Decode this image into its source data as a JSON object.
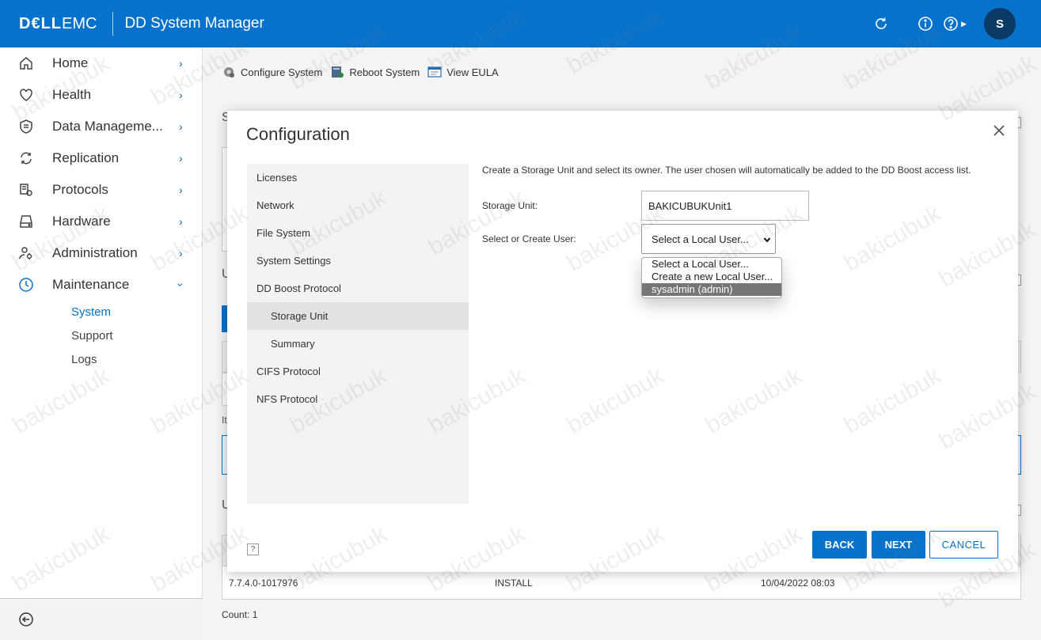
{
  "header": {
    "logo_dell": "D€LL",
    "logo_emc": "EMC",
    "app_title": "DD System Manager",
    "user_initial": "S",
    "icons": [
      "refresh-icon",
      "info-icon",
      "help-icon",
      "user-avatar"
    ]
  },
  "sidebar": {
    "items": [
      {
        "label": "Home",
        "icon": "home-icon"
      },
      {
        "label": "Health",
        "icon": "heart-icon"
      },
      {
        "label": "Data Manageme...",
        "icon": "shield-icon"
      },
      {
        "label": "Replication",
        "icon": "sync-icon"
      },
      {
        "label": "Protocols",
        "icon": "protocols-icon"
      },
      {
        "label": "Hardware",
        "icon": "drive-icon"
      },
      {
        "label": "Administration",
        "icon": "admin-user-icon"
      },
      {
        "label": "Maintenance",
        "icon": "clock-icon"
      }
    ],
    "sub_items": [
      "System",
      "Support",
      "Logs"
    ]
  },
  "toolbar": {
    "configure": "Configure System",
    "reboot": "Reboot System",
    "eula": "View EULA"
  },
  "background": {
    "frag_s": "S",
    "frag_u1": "U",
    "frag_it": "It",
    "frag_u2": "U",
    "row_version": "7.7.4.0-1017976",
    "row_action": "INSTALL",
    "row_date": "10/04/2022 08:03",
    "count": "Count: 1"
  },
  "modal": {
    "title": "Configuration",
    "steps": [
      {
        "label": "Licenses",
        "level": 1
      },
      {
        "label": "Network",
        "level": 1
      },
      {
        "label": "File System",
        "level": 1
      },
      {
        "label": "System Settings",
        "level": 1
      },
      {
        "label": "DD Boost Protocol",
        "level": 1
      },
      {
        "label": "Storage Unit",
        "level": 2,
        "active": true
      },
      {
        "label": "Summary",
        "level": 2
      },
      {
        "label": "CIFS Protocol",
        "level": 1
      },
      {
        "label": "NFS Protocol",
        "level": 1
      }
    ],
    "description": "Create a Storage Unit and select its owner. The user chosen will automatically be added to the DD Boost access list.",
    "storage_unit_label": "Storage Unit:",
    "storage_unit_value": "BAKICUBUKUnit1",
    "user_label": "Select or Create User:",
    "user_select_value": "Select a Local User...",
    "user_options": [
      "Select a Local User...",
      "Create a new Local User...",
      "sysadmin (admin)"
    ],
    "help": "?",
    "back": "BACK",
    "next": "NEXT",
    "cancel": "CANCEL"
  },
  "watermark": "bakicubuk",
  "colors": {
    "brand_blue": "#0672cb",
    "avatar_bg": "#0b3a66",
    "selected_option_bg": "#757575"
  }
}
